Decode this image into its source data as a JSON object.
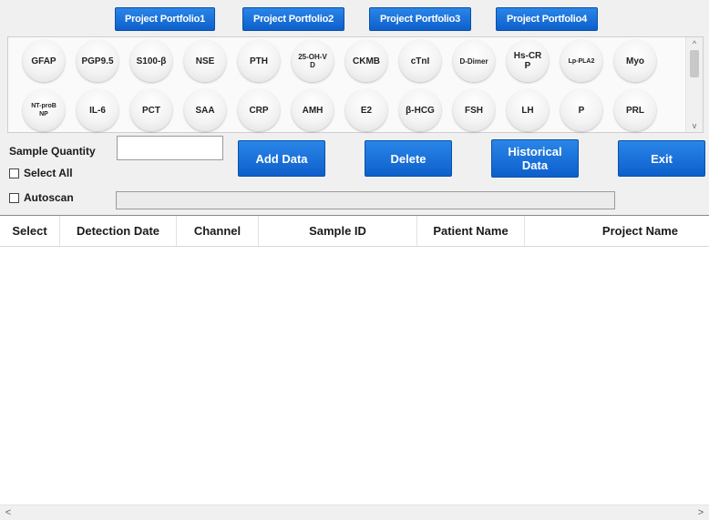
{
  "portfolios": [
    "Project Portfolio1",
    "Project Portfolio2",
    "Project Portfolio3",
    "Project Portfolio4"
  ],
  "items_row1": [
    "GFAP",
    "PGP9.5",
    "S100-β",
    "NSE",
    "PTH",
    "25-OH-V\nD",
    "CKMB",
    "cTnI",
    "D-Dimer",
    "Hs-CR\nP",
    "Lp-PLA2",
    "Myo"
  ],
  "items_row2": [
    "NT-proB\nNP",
    "IL-6",
    "PCT",
    "SAA",
    "CRP",
    "AMH",
    "E2",
    "β-HCG",
    "FSH",
    "LH",
    "P",
    "PRL"
  ],
  "sample_quantity": {
    "label": "Sample Quantity",
    "value": ""
  },
  "select_all_label": "Select All",
  "autoscan_label": "Autoscan",
  "buttons": {
    "add_data": "Add Data",
    "delete": "Delete",
    "historical_data": "Historical\nData",
    "exit": "Exit"
  },
  "scroll_arrows": {
    "up": "^",
    "down": "v",
    "left": "<",
    "right": ">"
  },
  "table": {
    "columns": [
      "Select",
      "Detection Date",
      "Channel",
      "Sample ID",
      "Patient Name",
      "Project Name"
    ],
    "rows": []
  },
  "colors": {
    "accent": "#1570dd",
    "panel": "#f0f0f0"
  }
}
